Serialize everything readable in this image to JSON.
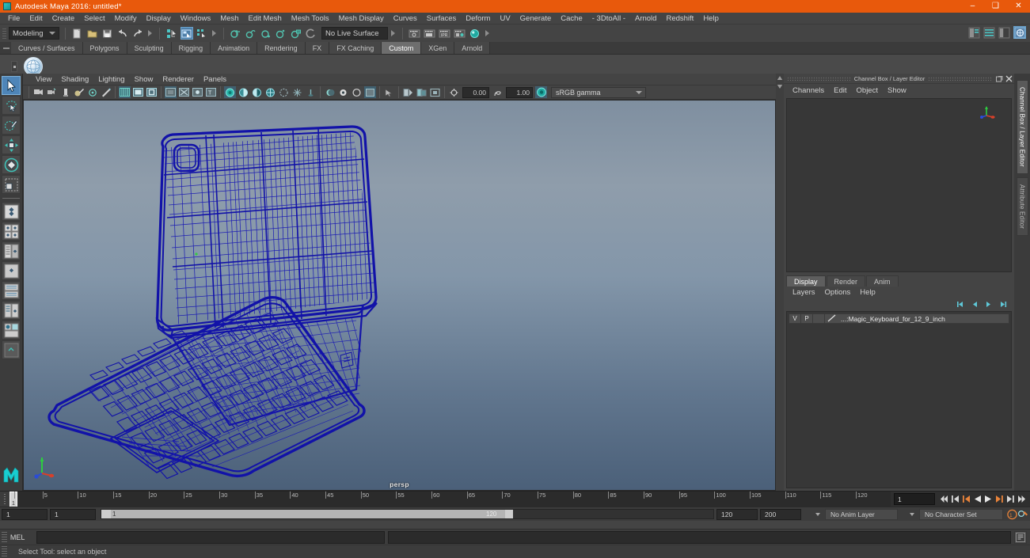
{
  "window": {
    "title": "Autodesk Maya 2016: untitled*",
    "app_icon": "maya-icon",
    "minimize": "–",
    "maximize": "❑",
    "close": "✕",
    "titlebar_color": "#e8590c"
  },
  "menubar": {
    "items": [
      "File",
      "Edit",
      "Create",
      "Select",
      "Modify",
      "Display",
      "Windows",
      "Mesh",
      "Edit Mesh",
      "Mesh Tools",
      "Mesh Display",
      "Curves",
      "Surfaces",
      "Deform",
      "UV",
      "Generate",
      "Cache",
      "- 3DtoAll -",
      "Arnold",
      "Redshift",
      "Help"
    ]
  },
  "statusline": {
    "menuset": "Modeling",
    "live_surface": "No Live Surface",
    "icons": [
      "new-scene-icon",
      "open-scene-icon",
      "save-scene-icon",
      "undo-icon",
      "redo-icon",
      "select-by-hierarchy-icon",
      "select-by-object-icon",
      "select-by-component-icon",
      "snap-to-grid-icon",
      "snap-to-curve-icon",
      "snap-to-point-icon",
      "snap-to-projected-center-icon",
      "snap-to-view-plane-icon",
      "make-live-icon",
      "render-current-frame-icon",
      "ipr-render-icon",
      "render-sequence-icon",
      "render-settings-icon",
      "hypershade-icon"
    ],
    "right_icons": [
      "show-hide-attribute-editor-icon",
      "show-hide-tool-settings-icon",
      "show-hide-channel-box-icon",
      "sidebar-toggle-icon"
    ]
  },
  "shelf": {
    "tabs": [
      "Curves / Surfaces",
      "Polygons",
      "Sculpting",
      "Rigging",
      "Animation",
      "Rendering",
      "FX",
      "FX Caching",
      "Custom",
      "XGen",
      "Arnold"
    ],
    "selected_tab": "Custom",
    "button_icon": "sphere-shelf-icon"
  },
  "toolbox": {
    "tools": [
      {
        "name": "select-tool",
        "selected": true
      },
      {
        "name": "lasso-select-tool",
        "selected": false
      },
      {
        "name": "paint-select-tool",
        "selected": false
      },
      {
        "name": "move-tool",
        "selected": false
      },
      {
        "name": "rotate-tool",
        "selected": false
      },
      {
        "name": "scale-tool",
        "selected": false
      }
    ],
    "layouts": [
      {
        "name": "single-perspective-layout"
      },
      {
        "name": "four-view-layout"
      },
      {
        "name": "two-panes-side-by-side-layout"
      },
      {
        "name": "two-panes-stacked-layout"
      },
      {
        "name": "three-panes-split-layout"
      },
      {
        "name": "outliner-persp-layout"
      },
      {
        "name": "hypergraph-persp-layout"
      },
      {
        "name": "persp-graph-editor-layout"
      }
    ],
    "logo": "maya-logo"
  },
  "viewport": {
    "menus": [
      "View",
      "Shading",
      "Lighting",
      "Show",
      "Renderer",
      "Panels"
    ],
    "camera_label": "persp",
    "exposure_value": "0.00",
    "gamma_value": "1.00",
    "color_management": "sRGB gamma",
    "toolbar_icons": [
      "select-camera-icon",
      "lock-camera-icon",
      "camera-attributes-icon",
      "bookmarks-icon",
      "image-plane-icon",
      "two-d-pan-zoom-icon",
      "grid-toggle-icon",
      "film-gate-icon",
      "resolution-gate-icon",
      "gate-mask-icon",
      "xray-icon",
      "xray-joints-icon",
      "xray-active-components-icon",
      "wireframe-icon",
      "smooth-shade-all-icon",
      "smooth-shade-selected-icon",
      "flat-shade-icon",
      "shaded-wireframe-icon",
      "textured-icon",
      "use-default-lighting-icon",
      "use-all-lights-icon",
      "shadows-icon",
      "screen-space-ao-icon",
      "motion-blur-icon",
      "multisample-icon",
      "depth-of-field-icon",
      "isolate-select-icon",
      "exposure-icon",
      "gamma-icon",
      "color-management-icon"
    ],
    "model_name": "Magic Keyboard for 12.9 inch iPad Pro wireframe",
    "wireframe_color": "#1a1a9e",
    "background_top": "#7f8fa0",
    "background_bottom": "#4b6079",
    "axis_gizmo": "axis-gizmo"
  },
  "channel_box": {
    "panel_title": "Channel Box / Layer Editor",
    "menus": [
      "Channels",
      "Edit",
      "Object",
      "Show"
    ],
    "float_icon": "undock-icon",
    "close_icon": "close-icon",
    "mini_axis_icon": "orientation-axis-icon"
  },
  "layer_editor": {
    "tabs": [
      "Display",
      "Render",
      "Anim"
    ],
    "selected_tab": "Display",
    "menus": [
      "Layers",
      "Options",
      "Help"
    ],
    "toolbar_icons": [
      "layer-move-first-icon",
      "layer-move-up-icon",
      "layer-move-down-icon",
      "layer-move-last-icon"
    ],
    "layers": [
      {
        "visibility": "V",
        "playback": "P",
        "shading": "",
        "color_swatch": "layer-color-swatch",
        "name": "...:Magic_Keyboard_for_12_9_inch"
      }
    ]
  },
  "right_vertical_tabs": {
    "items": [
      "Channel Box / Layer Editor",
      "Attribute Editor"
    ],
    "selected": "Channel Box / Layer Editor"
  },
  "timeline": {
    "current_frame": "1",
    "current_frame_field": "1",
    "ticks": [
      1,
      5,
      10,
      15,
      20,
      25,
      30,
      35,
      40,
      45,
      50,
      55,
      60,
      65,
      70,
      75,
      80,
      85,
      90,
      95,
      100,
      105,
      110,
      115,
      120
    ],
    "start_label": "1",
    "end_label": "120",
    "playback_buttons": [
      "go-to-start-icon",
      "step-back-frame-icon",
      "step-back-key-icon",
      "play-backwards-icon",
      "play-forwards-icon",
      "step-forward-key-icon",
      "step-forward-frame-icon",
      "go-to-end-icon"
    ]
  },
  "range": {
    "anim_start": "1",
    "anim_end": "1",
    "range_start_label": "1",
    "range_end_label": "120",
    "playback_end": "120",
    "anim_end_field": "200",
    "slider_end_value": "120",
    "anim_layer": "No Anim Layer",
    "character_set": "No Character Set",
    "auto_key_icon": "auto-keyframe-icon",
    "animation_prefs_icon": "animation-preferences-icon"
  },
  "command_line": {
    "language_label": "MEL",
    "input_value": "",
    "input_placeholder": "",
    "output_value": "",
    "script_editor_icon": "script-editor-icon"
  },
  "help_line": {
    "text": "Select Tool: select an object"
  }
}
